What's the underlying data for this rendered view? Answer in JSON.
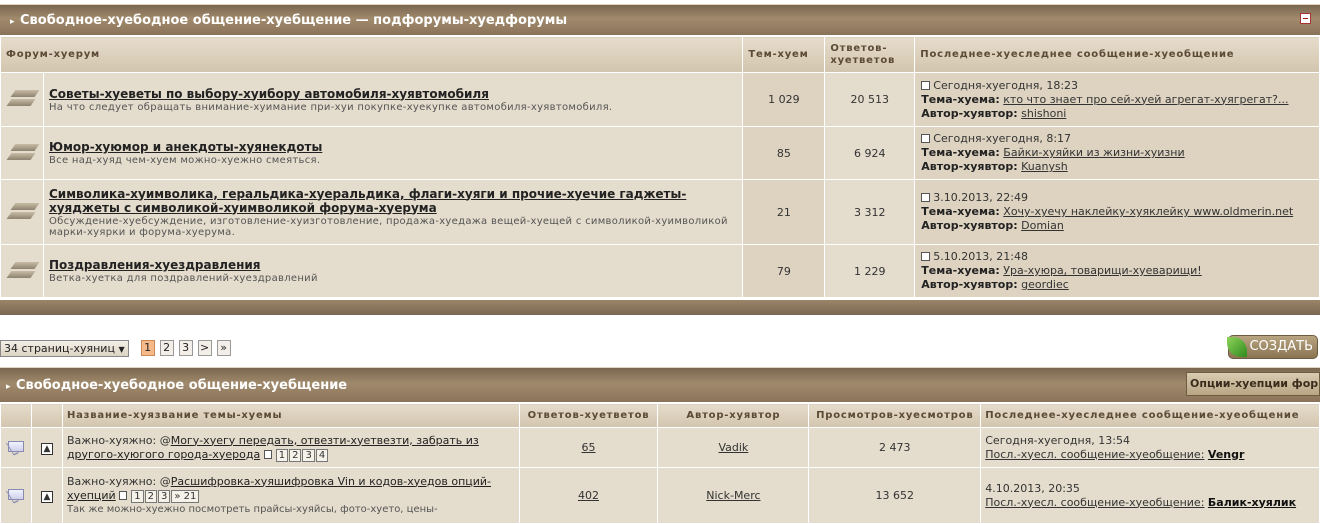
{
  "section1": {
    "title": "Свободное-хуебодное общение-хуебщение — подфорумы-хуедфорумы",
    "collapse_icon": "minus-box-icon",
    "headers": {
      "forum": "Форум-хуерум",
      "topics": "Тем-хуем",
      "replies": "Ответов-хуетветов",
      "last": "Последнее-хуеследнее сообщение-хуеобщение"
    },
    "forums": [
      {
        "title": "Советы-хуеветы по выбору-хуибору автомобиля-хуявтомобиля",
        "desc": "На что следует обращать внимание-хуимание при-хуи покупке-хуекупке автомобиля-хуявтомобиля.",
        "topics": "1 029",
        "replies": "20 513",
        "date": "Сегодня-хуегодня, 18:23",
        "topic_label": "Тема-хуема:",
        "topic": "кто что знает про сей-хуей агрегат-хуягрегат?...",
        "author_label": "Автор-хуявтор:",
        "author": "shishoni"
      },
      {
        "title": "Юмор-хуюмор и анекдоты-хуянекдоты",
        "desc": "Все над-хуяд чем-хуем можно-хуежно смеяться.",
        "topics": "85",
        "replies": "6 924",
        "date": "Сегодня-хуегодня, 8:17",
        "topic_label": "Тема-хуема:",
        "topic": "Байки-хуяйки из жизни-хуизни",
        "author_label": "Автор-хуявтор:",
        "author": "Kuanysh"
      },
      {
        "title": "Символика-хуимволика, геральдика-хуеральдика, флаги-хуяги и прочие-хуечие гаджеты-хуяджеты с символикой-хуимволикой форума-хуерума",
        "desc": "Обсуждение-хуебсуждение, изготовление-хуизготовление, продажа-хуедажа вещей-хуещей с символикой-хуимволикой марки-хуярки и форума-хуерума.",
        "topics": "21",
        "replies": "3 312",
        "date": "3.10.2013, 22:49",
        "topic_label": "Тема-хуема:",
        "topic": "Хочу-хуечу наклейку-хуяклейку www.oldmerin.net",
        "author_label": "Автор-хуявтор:",
        "author": "Domian"
      },
      {
        "title": "Поздравления-хуездравления",
        "desc": "Ветка-хуетка для поздравлений-хуездравлений",
        "topics": "79",
        "replies": "1 229",
        "date": "5.10.2013, 21:48",
        "topic_label": "Тема-хуема:",
        "topic": "Ура-хуюра, товарищи-хуеварищи!",
        "author_label": "Автор-хуявтор:",
        "author": "geordiec"
      }
    ]
  },
  "pager": {
    "pages_label": "34 страниц-хуяниц",
    "pages": [
      "1",
      "2",
      "3"
    ],
    "next": ">",
    "last": "»",
    "create": "СОЗДАТЬ"
  },
  "section2": {
    "title": "Свободное-хуебодное общение-хуебщение",
    "options": "Опции-хуепции фор",
    "headers": {
      "title": "Название-хуязвание темы-хуемы",
      "replies": "Ответов-хуетветов",
      "author": "Автор-хуявтор",
      "views": "Просмотров-хуесмотров",
      "last": "Последнее-хуеследнее сообщение-хуеобщение"
    },
    "topics": [
      {
        "prefix": "Важно-хуяжно:",
        "title": "Могу-хуегу передать, отвезти-хуетвезти, забрать из другого-хуюгого города-хуерода",
        "pages": [
          "1",
          "2",
          "3",
          "4"
        ],
        "replies": "65",
        "author": "Vadik",
        "views": "2 473",
        "date": "Сегодня-хуегодня, 13:54",
        "last_label": "Посл.-хуесл. сообщение-хуеобщение:",
        "last_author": "Vengr"
      },
      {
        "prefix": "Важно-хуяжно:",
        "title": "Расшифровка-хуяшифровка Vin и кодов-хуедов опций-хуепций",
        "pages": [
          "1",
          "2",
          "3",
          "» 21"
        ],
        "desc": "Так же можно-хуежно посмотреть прайсы-хуяйсы, фото-хуето, цены-",
        "replies": "402",
        "author": "Nick-Merc",
        "views": "13 652",
        "date": "4.10.2013, 20:35",
        "last_label": "Посл.-хуесл. сообщение-хуеобщение:",
        "last_author": "Балик-хуялик"
      }
    ]
  }
}
